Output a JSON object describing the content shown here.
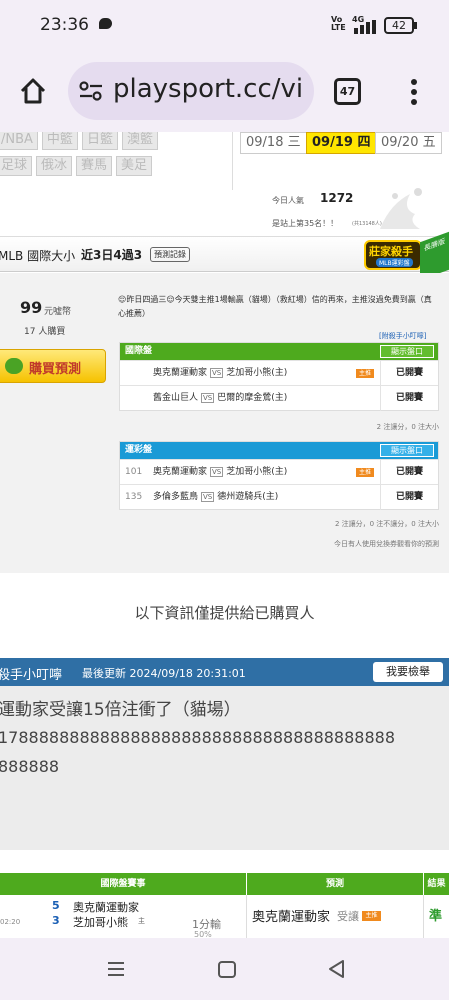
{
  "status_bar": {
    "time": "23:36",
    "network": "4G",
    "volte": "Vo LTE",
    "battery": "42"
  },
  "browser": {
    "url": "playsport.cc/vi",
    "tab_count": "47"
  },
  "league_tags": [
    "/NBA",
    "中籃",
    "日籃",
    "澳籃",
    "足球",
    "俄冰",
    "賽馬",
    "美足"
  ],
  "dates": [
    {
      "label": "09/18 三",
      "active": false
    },
    {
      "label": "09/19 四",
      "active": true
    },
    {
      "label": "09/20 五",
      "active": false
    }
  ],
  "popularity": {
    "label": "今日人氣",
    "value": "1272",
    "rank_text": "是站上第35名！！",
    "rank_sub": "(共13148人)"
  },
  "header": {
    "title": "MLB 國際大小",
    "record": "近3日4過3",
    "history_button": "預測記錄",
    "badge_main": "莊家殺手",
    "badge_sub": "MLB運彩盤",
    "badge_ribbon": "長勝版"
  },
  "price": {
    "value": "99",
    "unit": "元噓幣",
    "buyers": "17 人購買"
  },
  "buy_button": "購買預測",
  "message": "😌昨日四過三😌今天雙主推1場輸贏（貓場）（救紅場）信的再來，主推沒過免費到贏（真心推薦）",
  "tips_link": "[附殺手小叮嚀]",
  "intl_table": {
    "title": "國際盤",
    "button": "顯示盤口",
    "rows": [
      {
        "no": "",
        "away": "奧克蘭運動家",
        "home": "芝加哥小熊(主)",
        "hand": "主推",
        "status": "已開賽"
      },
      {
        "no": "",
        "away": "舊金山巨人",
        "home": "巴爾的摩金鶯(主)",
        "hand": "",
        "status": "已開賽"
      }
    ],
    "note": "2 注讓分，0 注大小"
  },
  "lottery_table": {
    "title": "運彩盤",
    "button": "顯示盤口",
    "rows": [
      {
        "no": "101",
        "away": "奧克蘭運動家",
        "home": "芝加哥小熊(主)",
        "hand": "主推",
        "status": "已開賽"
      },
      {
        "no": "135",
        "away": "多倫多藍鳥",
        "home": "德州遊騎兵(主)",
        "hand": "",
        "status": "已開賽"
      }
    ],
    "note": "2 注讓分，0 注不讓分，0 注大小",
    "coupon_note": "今日有人使用兌換券觀看你的預測"
  },
  "info_notice": "以下資訊僅提供給已購買人",
  "tips_panel": {
    "title": "殺手小叮嚀",
    "updated": "最後更新 2024/09/18 20:31:01",
    "report_button": "我要檢舉",
    "line1": "運動家受讓15倍注衝了（貓場）",
    "line2": "178888888888888888888888888888888888888",
    "line3": "888888"
  },
  "bottom_table": {
    "headers": [
      "國際盤賽事",
      "預測",
      "結果"
    ],
    "row": {
      "time": "02:20",
      "away_score": "5",
      "home_score": "3",
      "away": "奧克蘭運動家",
      "home": "芝加哥小熊",
      "home_tag": "主",
      "line": "1分輸",
      "line_sub": "50%",
      "pick": "奧克蘭運動家",
      "pick_type": "受讓",
      "pick_tag": "主推",
      "result": "準"
    }
  },
  "nav": {
    "recent": "recent-apps",
    "home": "home",
    "back": "back"
  }
}
